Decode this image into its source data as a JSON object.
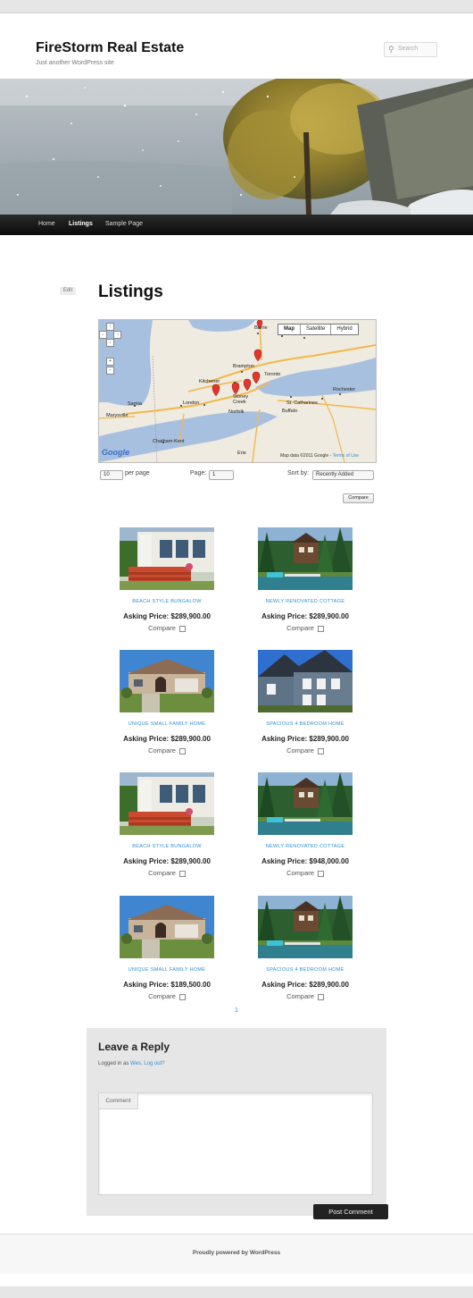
{
  "site": {
    "title": "FireStorm Real Estate",
    "description": "Just another WordPress site",
    "search_placeholder": "Search"
  },
  "nav": {
    "items": [
      "Home",
      "Listings",
      "Sample Page"
    ],
    "active": "Listings"
  },
  "edit_label": "Edit",
  "page_title": "Listings",
  "map": {
    "types": [
      "Map",
      "Satellite",
      "Hybrid"
    ],
    "selected_type": "Map",
    "credit": "Map data ©2011 Google -",
    "credit_link": "Terms of Use",
    "logo": "Google",
    "cities": [
      "Barrie",
      "Markham",
      "Oshawa",
      "Vaughan",
      "Brampton",
      "Toronto",
      "Oakville",
      "Kitchener",
      "Cambridge",
      "Brantford",
      "Stoney Creek",
      "St. Catharines",
      "London",
      "Norfolk",
      "Sarnia",
      "Rochester",
      "Buffalo",
      "Erie",
      "Chatham-Kent",
      "Marysville"
    ]
  },
  "controls": {
    "per_page_value": "10",
    "per_page_label": "per page",
    "page_label": "Page:",
    "page_value": "1",
    "sort_label": "Sort by:",
    "sort_value": "Recently Added"
  },
  "compare_button": "Compare",
  "listings": [
    {
      "name": "Beach Style Bungalow",
      "price": "Asking Price: $289,900.00",
      "compare": "Compare",
      "photo": "bungalow"
    },
    {
      "name": "Newly Renovated Cottage",
      "price": "Asking Price: $289,900.00",
      "compare": "Compare",
      "photo": "cottage"
    },
    {
      "name": "Unique Small Family Home",
      "price": "Asking Price: $289,900.00",
      "compare": "Compare",
      "photo": "family"
    },
    {
      "name": "Spacious 4 Bedroom Home",
      "price": "Asking Price: $289,900.00",
      "compare": "Compare",
      "photo": "spacious"
    },
    {
      "name": "Beach Style Bungalow",
      "price": "Asking Price: $289,900.00",
      "compare": "Compare",
      "photo": "bungalow"
    },
    {
      "name": "Newly Renovated Cottage",
      "price": "Asking Price: $948,000.00",
      "compare": "Compare",
      "photo": "cottage"
    },
    {
      "name": "Unique Small Family Home",
      "price": "Asking Price: $189,500.00",
      "compare": "Compare",
      "photo": "family"
    },
    {
      "name": "Spacious 4 Bedroom Home",
      "price": "Asking Price: $289,900.00",
      "compare": "Compare",
      "photo": "cottage"
    }
  ],
  "pagination": "1",
  "reply": {
    "title": "Leave a Reply",
    "logged_in_prefix": "Logged in as",
    "user": "Wes.",
    "logout": "Log out?",
    "comment_label": "Comment",
    "submit": "Post Comment"
  },
  "footer": "Proudly powered by WordPress",
  "colors": {
    "link": "#2d8fd5",
    "nav_bg": "#111111",
    "reply_bg": "#e6e6e6",
    "button_dark": "#222222"
  }
}
